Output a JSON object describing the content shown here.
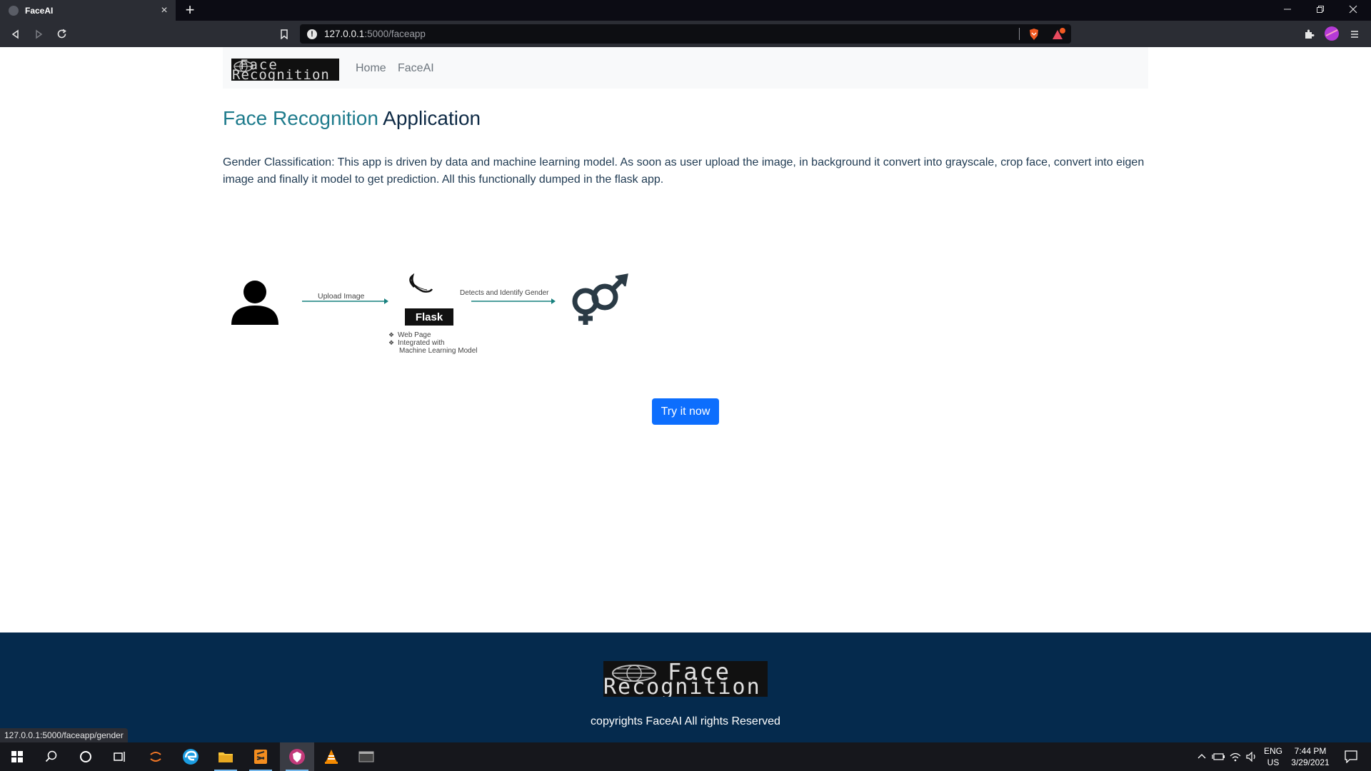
{
  "browser": {
    "tab_title": "FaceAI",
    "tab_close": "×",
    "new_tab": "+",
    "url_host": "127.0.0.1",
    "url_path": ":5000/faceapp",
    "status_url": "127.0.0.1:5000/faceapp/gender"
  },
  "navbar": {
    "logo_line1": "Face",
    "logo_line2": "Recognition",
    "links": [
      "Home",
      "FaceAI"
    ]
  },
  "main": {
    "title_accent": "Face Recognition",
    "title_main": "Application",
    "description": "Gender Classification: This app is driven by data and machine learning model. As soon as user upload the image, in background it convert into grayscale, crop face, convert into eigen image and finally it model to get prediction. All this functionally dumped in the flask app.",
    "diagram": {
      "upload_label": "Upload Image",
      "flask_label": "Flask",
      "detect_label": "Detects and Identify Gender",
      "bullets": [
        "Web Page",
        "Integrated with",
        "Machine Learning Model"
      ]
    },
    "cta": "Try it now"
  },
  "footer": {
    "logo_line1": "Face",
    "logo_line2": "Recognition",
    "copyright": "copyrights FaceAI All rights Reserved"
  },
  "taskbar": {
    "lang1": "ENG",
    "lang2": "US",
    "time": "7:44 PM",
    "date": "3/29/2021"
  },
  "colors": {
    "accent": "#1e7b8c",
    "heading": "#0e2a45",
    "button": "#0d6efd",
    "footer": "#052a4d"
  }
}
